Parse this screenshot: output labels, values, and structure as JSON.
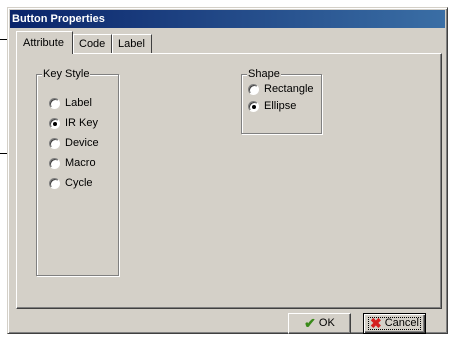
{
  "window": {
    "title": "Button Properties"
  },
  "tabs": [
    {
      "label": "Attribute",
      "active": true
    },
    {
      "label": "Code",
      "active": false
    },
    {
      "label": "Label",
      "active": false
    }
  ],
  "key_style": {
    "legend": "Key Style",
    "options": [
      {
        "label": "Label",
        "selected": false
      },
      {
        "label": "IR Key",
        "selected": true
      },
      {
        "label": "Device",
        "selected": false
      },
      {
        "label": "Macro",
        "selected": false
      },
      {
        "label": "Cycle",
        "selected": false
      }
    ]
  },
  "shape": {
    "legend": "Shape",
    "options": [
      {
        "label": "Rectangle",
        "selected": false
      },
      {
        "label": "Ellipse",
        "selected": true
      }
    ]
  },
  "buttons": {
    "ok_label": "OK",
    "cancel_label": "Cancel",
    "ok_icon": "checkmark-icon",
    "cancel_icon": "x-icon"
  },
  "colors": {
    "face": "#d4d0c8",
    "title_start": "#0a246a",
    "title_end": "#3a6ea5",
    "ok_icon": "#3a8a1a",
    "cancel_icon": "#d42020"
  }
}
